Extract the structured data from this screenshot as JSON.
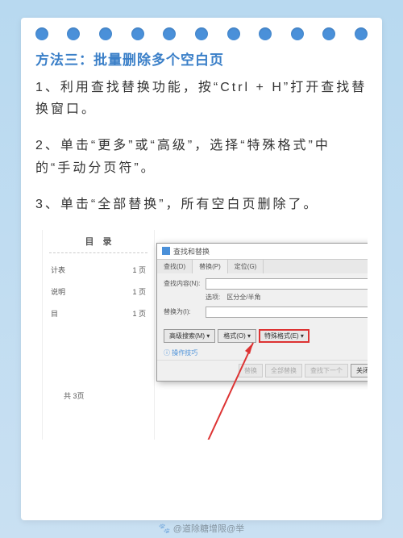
{
  "title": "方法三：批量删除多个空白页",
  "steps": [
    "1、利用查找替换功能，按“Ctrl + H”打开查找替换窗口。",
    "2、单击“更多”或“高级”，选择“特殊格式”中的“手动分页符”。",
    "3、单击“全部替换”，所有空白页删除了。"
  ],
  "doc": {
    "heading": "目 录",
    "rows": [
      {
        "l": "计表",
        "r": "1 页"
      },
      {
        "l": "说明",
        "r": "1 页"
      },
      {
        "l": "目",
        "r": "1 页"
      }
    ],
    "footer": "共 3页"
  },
  "dialog": {
    "title": "查找和替换",
    "close": "×",
    "tabs": [
      "查找(D)",
      "替换(P)",
      "定位(G)"
    ],
    "find_label": "查找内容(N):",
    "replace_label": "替换为(I):",
    "opts": "选项: 区分全/半角",
    "buttons": {
      "more": "高级搜索(M) ▾",
      "format": "格式(O) ▾",
      "special": "特殊格式(E) ▾",
      "replace": "替换",
      "replaceAll": "全部替换",
      "findNext": "查找下一个",
      "close": "关闭"
    },
    "tip": "ⓘ 操作技巧"
  },
  "watermark": "@道除糖增限@举"
}
